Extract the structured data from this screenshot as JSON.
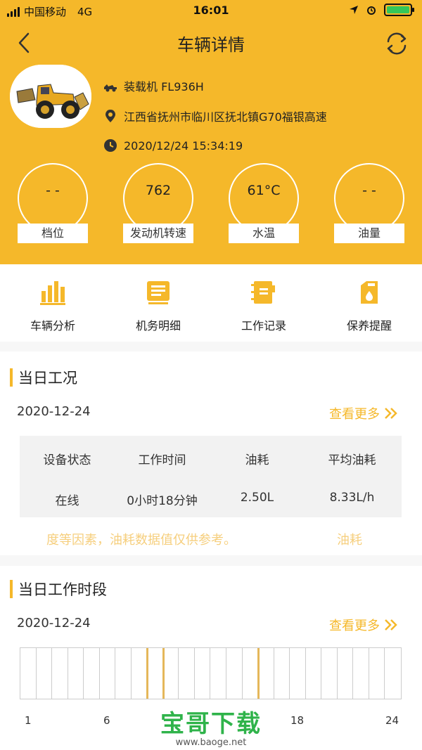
{
  "status": {
    "carrier": "中国移动",
    "network": "4G",
    "time": "16:01"
  },
  "nav": {
    "title": "车辆详情"
  },
  "vehicle": {
    "type": "装载机 FL936H",
    "location": "江西省抚州市临川区抚北镇G70福银高速",
    "datetime": "2020/12/24 15:34:19"
  },
  "gauges": [
    {
      "value": "- -",
      "label": "档位"
    },
    {
      "value": "762",
      "label": "发动机转速"
    },
    {
      "value": "61°C",
      "label": "水温"
    },
    {
      "value": "- -",
      "label": "油量"
    }
  ],
  "quick_actions": [
    {
      "label": "车辆分析",
      "icon": "bar-chart-icon"
    },
    {
      "label": "机务明细",
      "icon": "clipboard-icon"
    },
    {
      "label": "工作记录",
      "icon": "notebook-icon"
    },
    {
      "label": "保养提醒",
      "icon": "fuel-can-icon"
    }
  ],
  "daily_status": {
    "title": "当日工况",
    "date": "2020-12-24",
    "more": "查看更多",
    "headers": [
      "设备状态",
      "工作时间",
      "油耗",
      "平均油耗"
    ],
    "row": [
      "在线",
      "0小时18分钟",
      "2.50L",
      "8.33L/h"
    ],
    "notice": "度等因素，油耗数据值仅供参考。",
    "notice_tail": "油耗"
  },
  "daily_periods": {
    "title": "当日工作时段",
    "date": "2020-12-24",
    "more": "查看更多",
    "ticks": [
      "1",
      "6",
      "18",
      "24"
    ],
    "active_hours": [
      8,
      9,
      15
    ]
  },
  "watermark": {
    "main": "宝哥下载",
    "sub": "www.baoge.net"
  },
  "colors": {
    "accent": "#f5b82a",
    "active_slot": "#e5b75a",
    "watermark": "#2fb34a"
  }
}
